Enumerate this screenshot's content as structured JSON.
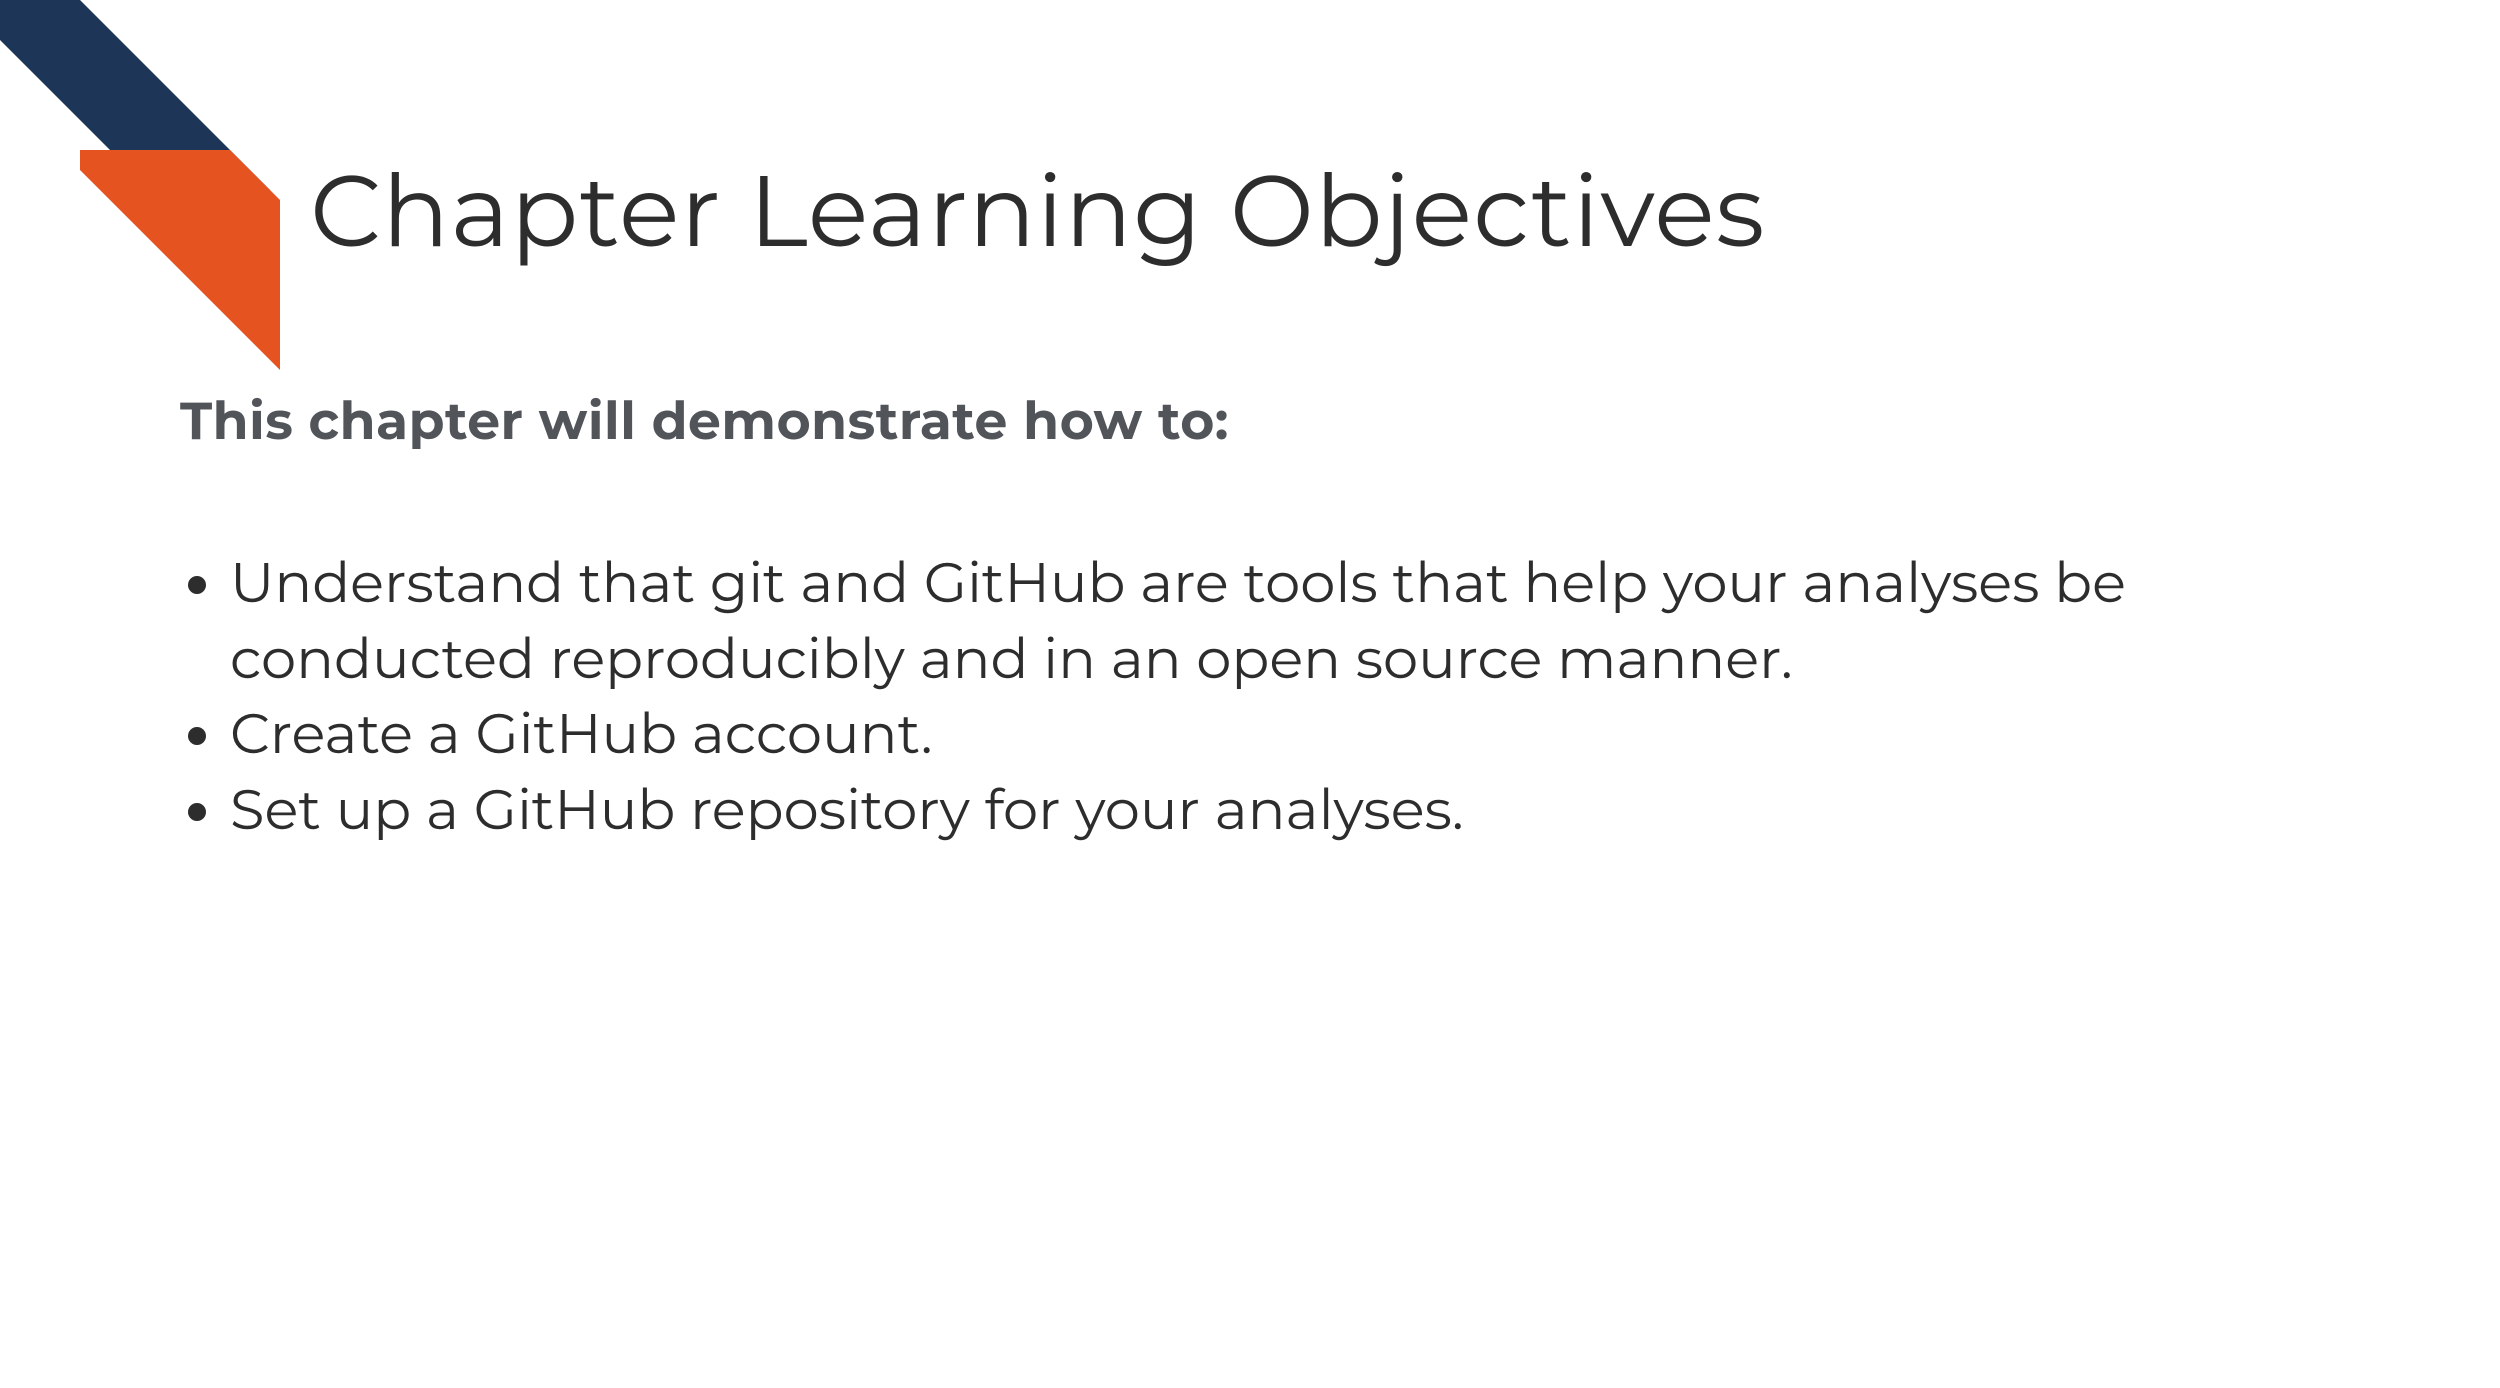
{
  "colors": {
    "accent_blue": "#1d3557",
    "accent_orange": "#e55321"
  },
  "title": "Chapter Learning Objectives",
  "subtitle": "This chapter will demonstrate how to:",
  "objectives": [
    "Understand that git and GitHub are tools that help your analyses be conducted reproducibly and in an open source manner.",
    "Create a GitHub account.",
    "Set up a GitHub repository for your analyses."
  ]
}
